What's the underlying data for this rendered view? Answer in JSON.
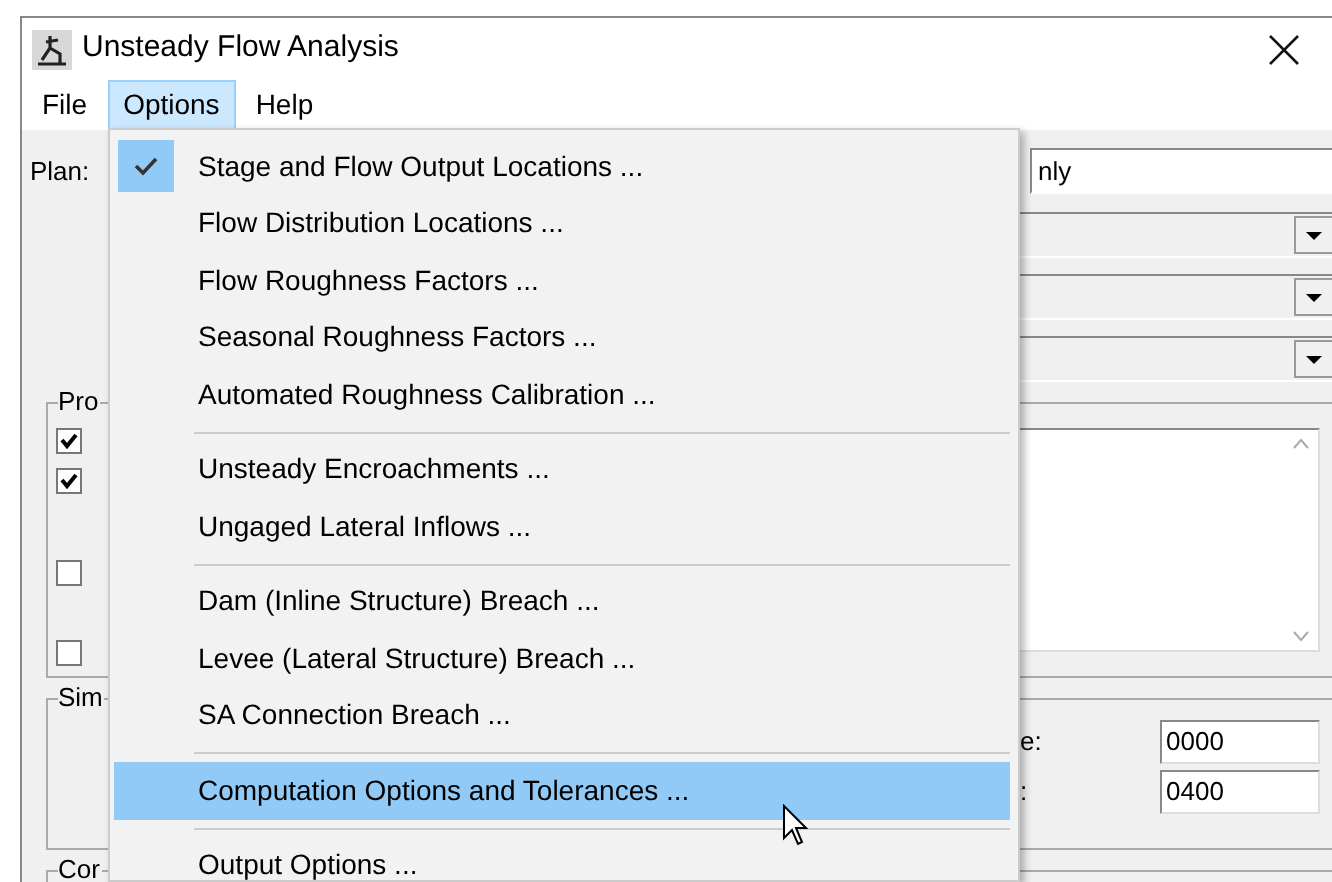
{
  "window": {
    "title": "Unsteady Flow Analysis"
  },
  "menu_bar": [
    {
      "label": "File",
      "selected": false
    },
    {
      "label": "Options",
      "selected": true
    },
    {
      "label": "Help",
      "selected": false
    }
  ],
  "plan": {
    "label": "Plan:",
    "value": "nly"
  },
  "groups": [
    {
      "title": "Pro",
      "checkboxes": [
        {
          "checked": true
        },
        {
          "checked": true
        },
        {
          "checked": false
        },
        {
          "checked": false
        }
      ]
    },
    {
      "title": "Sim",
      "fields": [
        {
          "label": "e:",
          "value": "0000"
        },
        {
          "label": ":",
          "value": "0400"
        }
      ]
    },
    {
      "title": "Cor"
    }
  ],
  "menu": [
    {
      "kind": "item",
      "label": "Stage and Flow Output Locations ...",
      "checked": true,
      "selected": false
    },
    {
      "kind": "item",
      "label": "Flow Distribution Locations ...",
      "checked": false,
      "selected": false
    },
    {
      "kind": "item",
      "label": "Flow Roughness Factors ...",
      "checked": false,
      "selected": false
    },
    {
      "kind": "item",
      "label": "Seasonal Roughness Factors ...",
      "checked": false,
      "selected": false
    },
    {
      "kind": "item",
      "label": "Automated Roughness Calibration ...",
      "checked": false,
      "selected": false
    },
    {
      "kind": "separator"
    },
    {
      "kind": "item",
      "label": "Unsteady Encroachments ...",
      "checked": false,
      "selected": false
    },
    {
      "kind": "item",
      "label": "Ungaged Lateral Inflows ...",
      "checked": false,
      "selected": false
    },
    {
      "kind": "separator"
    },
    {
      "kind": "item",
      "label": "Dam (Inline Structure) Breach ...",
      "checked": false,
      "selected": false
    },
    {
      "kind": "item",
      "label": "Levee (Lateral Structure) Breach ...",
      "checked": false,
      "selected": false
    },
    {
      "kind": "item",
      "label": "SA Connection Breach ...",
      "checked": false,
      "selected": false
    },
    {
      "kind": "separator"
    },
    {
      "kind": "item",
      "label": "Computation Options and Tolerances ...",
      "checked": false,
      "selected": true
    },
    {
      "kind": "separator"
    },
    {
      "kind": "item",
      "label": "Output Options ...",
      "checked": false,
      "selected": false
    }
  ]
}
